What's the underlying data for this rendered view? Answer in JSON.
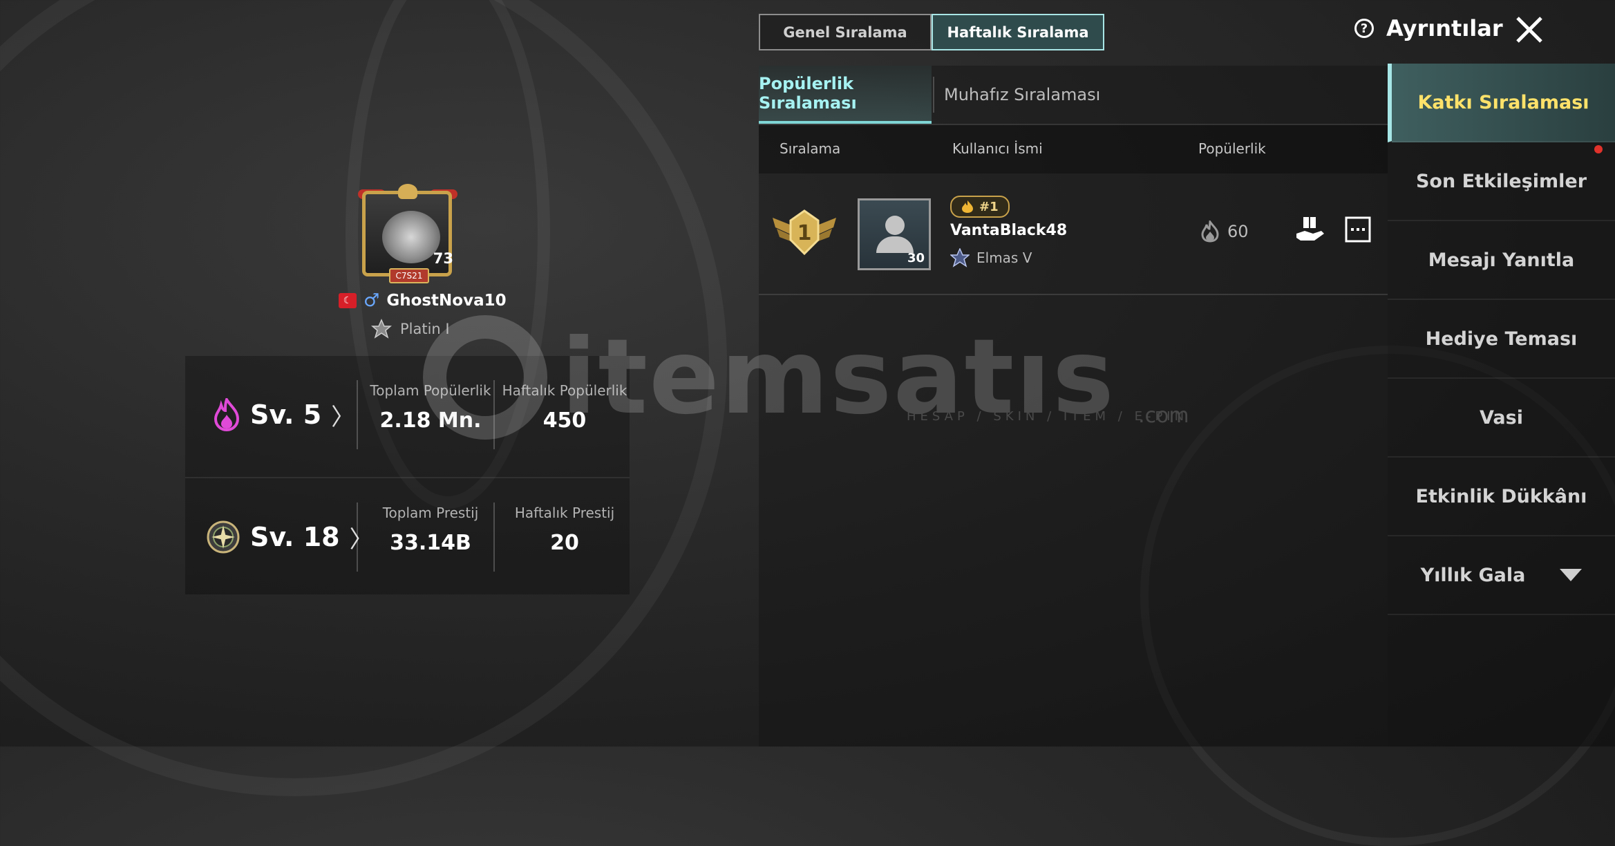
{
  "header": {
    "tabs": [
      "Genel Sıralama",
      "Haftalık Sıralama"
    ],
    "details_label": "Ayrıntılar"
  },
  "profile": {
    "emblem_level": "73",
    "emblem_tag": "C7S21",
    "player_name": "GhostNova10",
    "tier": "Platin I"
  },
  "stats": {
    "popularity": {
      "level": "Sv. 5",
      "total_label": "Toplam Popülerlik",
      "total_value": "2.18 Mn.",
      "weekly_label": "Haftalık Popülerlik",
      "weekly_value": "450"
    },
    "prestige": {
      "level": "Sv. 18",
      "total_label": "Toplam Prestij",
      "total_value": "33.14B",
      "weekly_label": "Haftalık Prestij",
      "weekly_value": "20"
    }
  },
  "ranking": {
    "subtabs": [
      "Popülerlik Sıralaması",
      "Muhafız Sıralaması"
    ],
    "columns": [
      "Sıralama",
      "Kullanıcı İsmi",
      "Popülerlik"
    ],
    "rows": [
      {
        "rank_badge": "#1",
        "avatar_level": "30",
        "name": "VantaBlack48",
        "tier": "Elmas V",
        "popularity": "60"
      }
    ]
  },
  "sidebar": {
    "items": [
      "Katkı Sıralaması",
      "Son Etkileşimler",
      "Mesajı Yanıtla",
      "Hediye Teması",
      "Vasi",
      "Etkinlik Dükkânı",
      "Yıllık Gala"
    ]
  },
  "watermark": {
    "text": "itemsatıs",
    "sub": "HESAP / SKIN / ITEM / E-PIN",
    "domain": ".com"
  },
  "colors": {
    "accent_teal": "#a6f2f2",
    "gold": "#c9a24b",
    "highlight_yellow": "#ffe26a",
    "notification_red": "#e0322b",
    "popularity_pink": "#e04ad8"
  }
}
